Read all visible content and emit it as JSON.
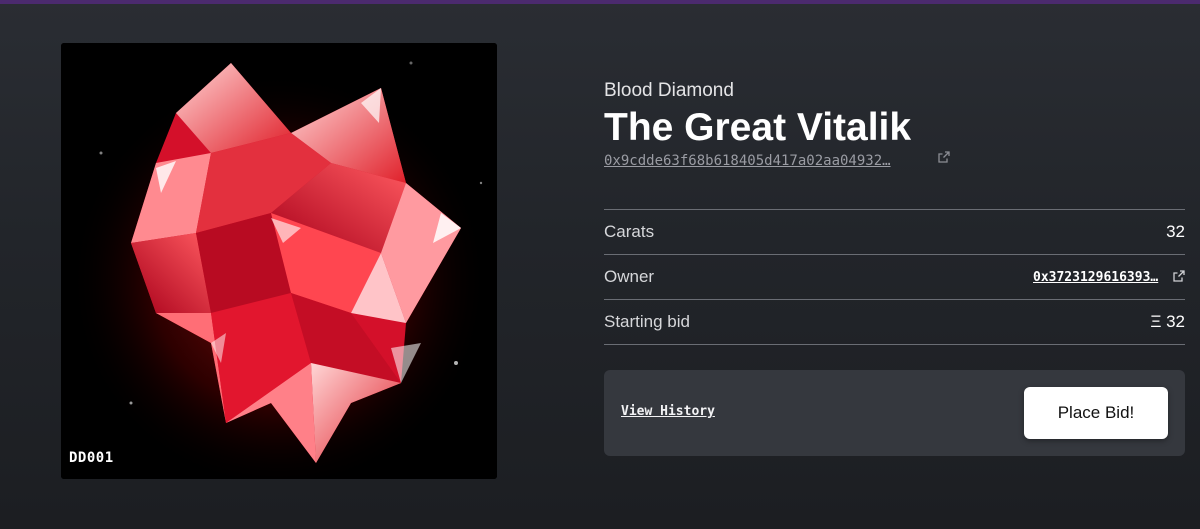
{
  "header": {
    "accent_color": "#4b2a6e"
  },
  "artwork": {
    "code": "DD001",
    "subject": "red-crystal-heart"
  },
  "item": {
    "collection": "Blood Diamond",
    "title": "The Great Vitalik",
    "contract_address": "0x9cdde63f68b618405d417a02aa04932…",
    "contract_link_icon": "external-link-icon"
  },
  "details": [
    {
      "label": "Carats",
      "value": "32"
    },
    {
      "label": "Owner",
      "value": "0x3723129616393…",
      "icon": "external-link-icon"
    },
    {
      "label": "Starting bid",
      "value": "Ξ 32"
    }
  ],
  "actions": {
    "history_label": "View History",
    "bid_label": "Place Bid!"
  }
}
